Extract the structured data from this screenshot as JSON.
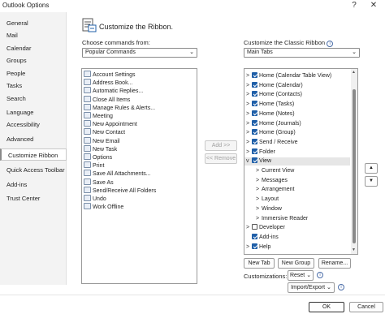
{
  "window": {
    "title": "Outlook Options",
    "help_glyph": "?",
    "close_glyph": "✕"
  },
  "sidebar": {
    "items": [
      {
        "label": "General"
      },
      {
        "label": "Mail"
      },
      {
        "label": "Calendar"
      },
      {
        "label": "Groups"
      },
      {
        "label": "People"
      },
      {
        "label": "Tasks"
      },
      {
        "label": "Search"
      },
      {
        "label": "Language"
      },
      {
        "label": "Accessibility"
      },
      {
        "label": "Advanced"
      },
      {
        "label": "Customize Ribbon",
        "active": true
      },
      {
        "label": "Quick Access Toolbar"
      },
      {
        "label": "Add-ins"
      },
      {
        "label": "Trust Center"
      }
    ]
  },
  "header": {
    "title": "Customize the Ribbon."
  },
  "left": {
    "label": "Choose commands from:",
    "select_value": "Popular Commands",
    "commands": [
      "Account Settings",
      "Address Book...",
      "Automatic Replies...",
      "Close All Items",
      "Manage Rules & Alerts...",
      "Meeting",
      "New Appointment",
      "New Contact",
      "New Email",
      "New Task",
      "Options",
      "Print",
      "Save All Attachments...",
      "Save As",
      "Send/Receive All Folders",
      "Undo",
      "Work Offline"
    ]
  },
  "middle": {
    "add_label": "Add >>",
    "remove_label": "<< Remove"
  },
  "right": {
    "label": "Customize the Classic Ribbon",
    "select_value": "Main Tabs",
    "tabs": [
      {
        "label": "Home (Calendar Table View)",
        "checked": true,
        "level": 0,
        "expander": ">"
      },
      {
        "label": "Home (Calendar)",
        "checked": true,
        "level": 0,
        "expander": ">"
      },
      {
        "label": "Home (Contacts)",
        "checked": true,
        "level": 0,
        "expander": ">"
      },
      {
        "label": "Home (Tasks)",
        "checked": true,
        "level": 0,
        "expander": ">"
      },
      {
        "label": "Home (Notes)",
        "checked": true,
        "level": 0,
        "expander": ">"
      },
      {
        "label": "Home (Journals)",
        "checked": true,
        "level": 0,
        "expander": ">"
      },
      {
        "label": "Home (Group)",
        "checked": true,
        "level": 0,
        "expander": ">"
      },
      {
        "label": "Send / Receive",
        "checked": true,
        "level": 0,
        "expander": ">"
      },
      {
        "label": "Folder",
        "checked": true,
        "level": 0,
        "expander": ">"
      },
      {
        "label": "View",
        "checked": true,
        "level": 0,
        "expander": "v",
        "selected": true
      },
      {
        "label": "Current View",
        "level": 1,
        "expander": ">"
      },
      {
        "label": "Messages",
        "level": 1,
        "expander": ">"
      },
      {
        "label": "Arrangement",
        "level": 1,
        "expander": ">"
      },
      {
        "label": "Layout",
        "level": 1,
        "expander": ">"
      },
      {
        "label": "Window",
        "level": 1,
        "expander": ">"
      },
      {
        "label": "Immersive Reader",
        "level": 1,
        "expander": ">"
      },
      {
        "label": "Developer",
        "checked": false,
        "level": 0,
        "expander": ">"
      },
      {
        "label": "Add-ins",
        "checked": true,
        "level": 0,
        "expander": ""
      },
      {
        "label": "Help",
        "checked": true,
        "level": 0,
        "expander": ">"
      }
    ],
    "new_tab": "New Tab",
    "new_group": "New Group",
    "rename": "Rename...",
    "customizations_label": "Customizations:",
    "reset": "Reset",
    "import_export": "Import/Export"
  },
  "footer": {
    "ok": "OK",
    "cancel": "Cancel"
  }
}
